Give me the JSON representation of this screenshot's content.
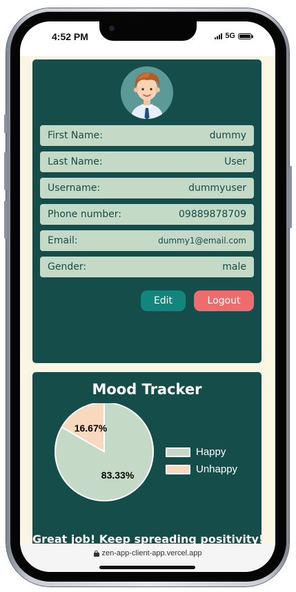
{
  "status_bar": {
    "time": "4:52 PM",
    "network": "5G"
  },
  "profile": {
    "avatar_icon": "user-avatar-icon",
    "fields": [
      {
        "label": "First Name:",
        "value": "dummy"
      },
      {
        "label": "Last Name:",
        "value": "User"
      },
      {
        "label": "Username:",
        "value": "dummyuser"
      },
      {
        "label": "Phone number:",
        "value": "09889878709"
      },
      {
        "label": "Email:",
        "value": "dummy1@email.com"
      },
      {
        "label": "Gender:",
        "value": "male"
      }
    ],
    "edit_label": "Edit",
    "logout_label": "Logout"
  },
  "mood": {
    "title": "Mood Tracker",
    "message": "Great job! Keep spreading positivity!"
  },
  "chart_data": {
    "type": "pie",
    "categories": [
      "Happy",
      "Unhappy"
    ],
    "values": [
      83.33,
      16.67
    ],
    "labels": [
      "83.33%",
      "16.67%"
    ],
    "colors": [
      "#c5dac6",
      "#f8d9bd"
    ],
    "legend": "right"
  },
  "browser": {
    "url": "zen-app-client-app.vercel.app"
  },
  "colors": {
    "card_bg": "#154d4a",
    "field_bg": "#c5dac6",
    "page_bg": "#fbf6e4",
    "edit_button": "#12857c",
    "logout_button": "#ef6c6c"
  }
}
